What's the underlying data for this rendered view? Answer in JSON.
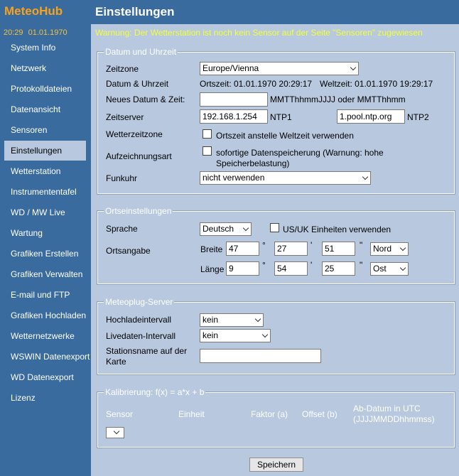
{
  "app": {
    "logo": "MeteoHub",
    "time": "20:29",
    "date": "01.01.1970"
  },
  "sidebar": {
    "items": [
      {
        "label": "System Info"
      },
      {
        "label": "Netzwerk"
      },
      {
        "label": "Protokolldateien"
      },
      {
        "label": "Datenansicht"
      },
      {
        "label": "Sensoren"
      },
      {
        "label": "Einstellungen",
        "active": true
      },
      {
        "label": "Wetterstation"
      },
      {
        "label": "Instrumententafel"
      },
      {
        "label": "WD / MW Live"
      },
      {
        "label": "Wartung"
      },
      {
        "label": "Grafiken Erstellen"
      },
      {
        "label": "Grafiken Verwalten"
      },
      {
        "label": "E-mail und FTP"
      },
      {
        "label": "Grafiken Hochladen"
      },
      {
        "label": "Wetternetzwerke"
      },
      {
        "label": "WSWIN Datenexport"
      },
      {
        "label": "WD Datenexport"
      },
      {
        "label": "Lizenz"
      }
    ]
  },
  "header": {
    "title": "Einstellungen"
  },
  "warning": "Warnung: Der Wetterstation ist noch kein Sensor auf der Seite \"Sensoren\" zugewiesen",
  "datetime": {
    "legend": "Datum und Uhrzeit",
    "timezone_label": "Zeitzone",
    "timezone_value": "Europe/Vienna",
    "datetime_label": "Datum & Uhrzeit",
    "local_time": "Ortszeit: 01.01.1970 20:29:17",
    "world_time": "Weltzeit: 01.01.1970 19:29:17",
    "new_date_label": "Neues Datum & Zeit:",
    "new_date_value": "",
    "new_date_hint": "MMTThhmmJJJJ oder MMTThhmm",
    "timeserver_label": "Zeitserver",
    "ntp1_value": "192.168.1.254",
    "ntp1_label": "NTP1",
    "ntp2_value": "1.pool.ntp.org",
    "ntp2_label": "NTP2",
    "weather_tz_label": "Wetterzeitzone",
    "weather_tz_checkbox": "Ortszeit anstelle Weltzeit verwenden",
    "weather_tz_checked": false,
    "recording_label": "Aufzeichnungsart",
    "recording_checkbox": "sofortige Datenspeicherung (Warnung: hohe Speicherbelastung)",
    "recording_checked": false,
    "radioclock_label": "Funkuhr",
    "radioclock_value": "nicht verwenden"
  },
  "location": {
    "legend": "Ortseinstellungen",
    "language_label": "Sprache",
    "language_value": "Deutsch",
    "us_units_label": "US/UK Einheiten verwenden",
    "us_units_checked": false,
    "position_label": "Ortsangabe",
    "lat_label": "Breite",
    "lat_deg": "47",
    "lat_min": "27",
    "lat_sec": "51",
    "lat_dir": "Nord",
    "lon_label": "Länge",
    "lon_deg": "9",
    "lon_min": "54",
    "lon_sec": "25",
    "lon_dir": "Ost",
    "deg_sym": "°",
    "min_sym": "'",
    "sec_sym": "\""
  },
  "meteoplug": {
    "legend": "Meteoplug-Server",
    "upload_label": "Hochladeintervall",
    "upload_value": "kein",
    "live_label": "Livedaten-Intervall",
    "live_value": "kein",
    "station_label": "Stationsname auf der Karte",
    "station_value": ""
  },
  "calibration": {
    "legend": "Kalibrierung: f(x) = a*x + b",
    "columns": [
      "Sensor",
      "Einheit",
      "Faktor (a)",
      "Offset (b)",
      "Ab-Datum in UTC (JJJJMMDDhhmmss)"
    ],
    "sensor_value": ""
  },
  "footer": {
    "save_label": "Speichern"
  }
}
